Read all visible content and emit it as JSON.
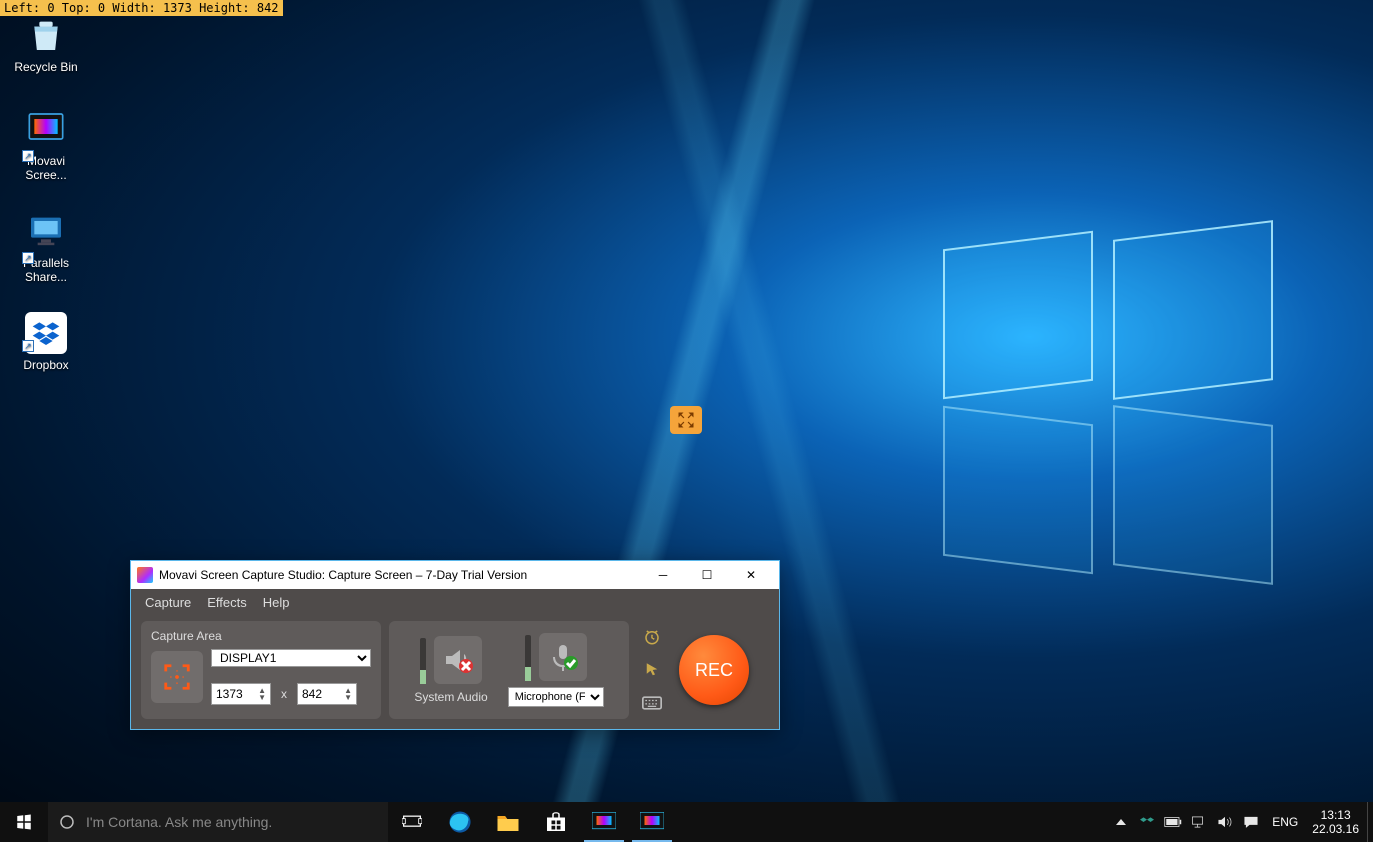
{
  "overlay": {
    "rect_info": "Left: 0  Top: 0  Width: 1373  Height: 842"
  },
  "desktop_icons": [
    {
      "name": "recycle-bin",
      "label": "Recycle Bin"
    },
    {
      "name": "movavi-screen",
      "label": "Movavi Scree..."
    },
    {
      "name": "parallels-shared",
      "label": "Parallels Share..."
    },
    {
      "name": "dropbox",
      "label": "Dropbox"
    }
  ],
  "movavi": {
    "title": "Movavi Screen Capture Studio: Capture Screen – 7-Day Trial Version",
    "menu": {
      "capture": "Capture",
      "effects": "Effects",
      "help": "Help"
    },
    "capture_area": {
      "header": "Capture Area",
      "display_select": "DISPLAY1",
      "width": "1373",
      "sep": "x",
      "height": "842"
    },
    "system_audio": {
      "label": "System Audio"
    },
    "microphone": {
      "label": "Microphone (F",
      "select": "Microphone (F"
    },
    "rec_label": "REC"
  },
  "taskbar": {
    "cortana_placeholder": "I'm Cortana. Ask me anything.",
    "lang": "ENG",
    "time": "13:13",
    "date": "22.03.16"
  }
}
